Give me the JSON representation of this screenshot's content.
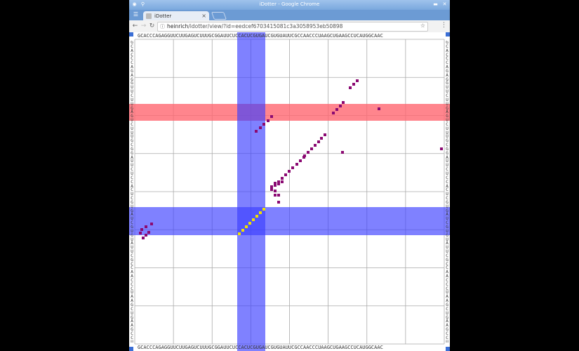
{
  "window": {
    "title": "iDotter - Google Chrome",
    "tab_label": "iDotter",
    "tab_close": "×",
    "url_host": "heinrich",
    "url_path": "/idotter/view/?id=eedcef6703415081c3a3058953eb50898",
    "minimize": "▬",
    "close": "✕"
  },
  "icons": {
    "back": "←",
    "forward": "→",
    "reload": "↻",
    "page": "ⓘ",
    "star": "☆",
    "menu": "⋮"
  },
  "sequence": "GCACCCAGAGGUUCUUGAGUCUUUGCGGAUUCUCCACUCGUGAUCGUGUAUUCGCCAACCCUAAGCUGAAGCCUCAUGGCAAC",
  "dotplot": {
    "grid_rows": 8,
    "grid_cols": 8,
    "colors": {
      "dot": "#8b0a72",
      "selected_dot": "#f0e000",
      "highlight_red": "#ff6670",
      "highlight_blue": "#3a3dff"
    }
  }
}
